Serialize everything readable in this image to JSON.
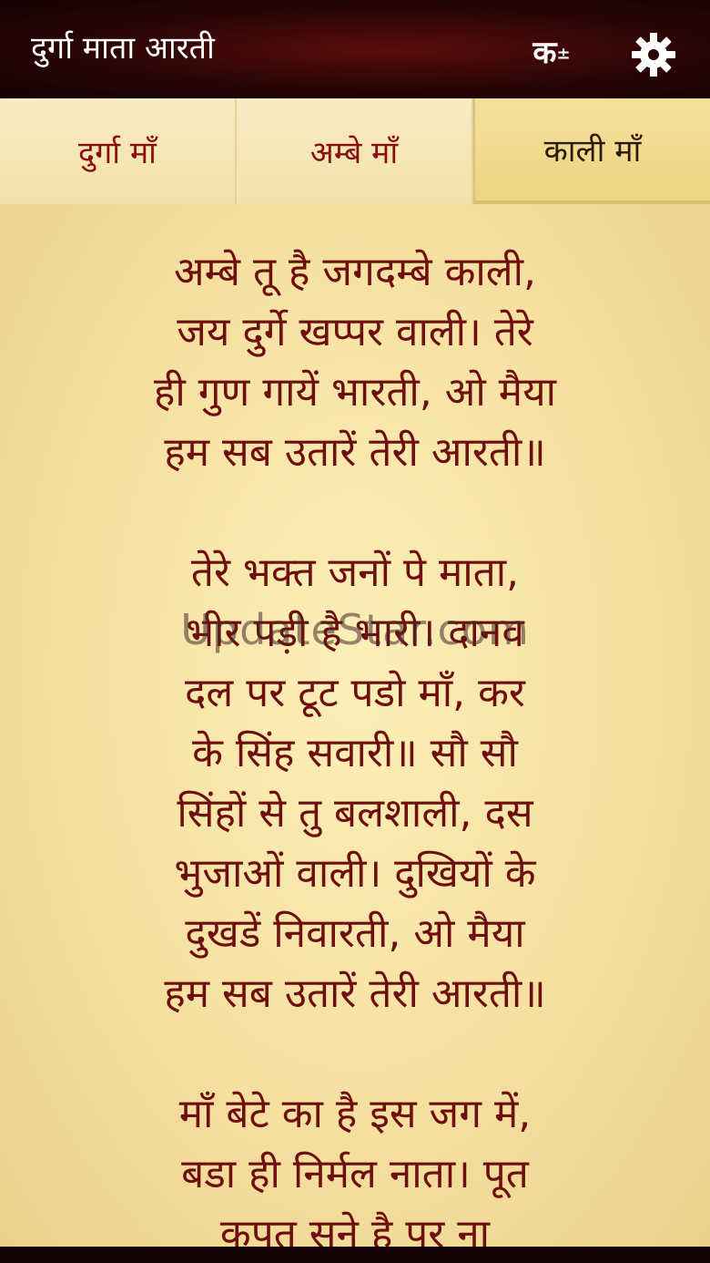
{
  "app_bar": {
    "title": "दुर्गा माता आरती",
    "font_button_label": "क",
    "font_button_suffix": "±",
    "font_icon": "font-size-icon",
    "settings_icon": "gear-icon"
  },
  "tabs": [
    {
      "label": "दुर्गा माँ",
      "active": false
    },
    {
      "label": "अम्बे माँ",
      "active": false
    },
    {
      "label": "काली माँ",
      "active": true
    }
  ],
  "verses": [
    "अम्बे तू है जगदम्बे काली,\nजय दुर्गे खप्पर वाली। तेरे\nही गुण गायें भारती, ओ मैया\nहम सब उतारें तेरी आरती॥",
    "तेरे भक्त जनों पे माता,\nभीर पड़ी है भारी। दानव\nदल पर टूट पडो माँ, कर\nके सिंह सवारी॥ सौ सौ\nसिंहों से तु बलशाली, दस\nभुजाओं वाली। दुखियों के\nदुखडें निवारती, ओ मैया\nहम सब उतारें तेरी आरती॥",
    "माँ बेटे का है इस जग में,\nबडा ही निर्मल नाता। पूत\nकपूत सुने है पर ना"
  ],
  "watermark": "UpdateStar.com",
  "colors": {
    "text": "#6e0e0e",
    "tab_text": "#8b0d0d",
    "appbar": "#2a0505",
    "paper": "#f5e0a0"
  }
}
